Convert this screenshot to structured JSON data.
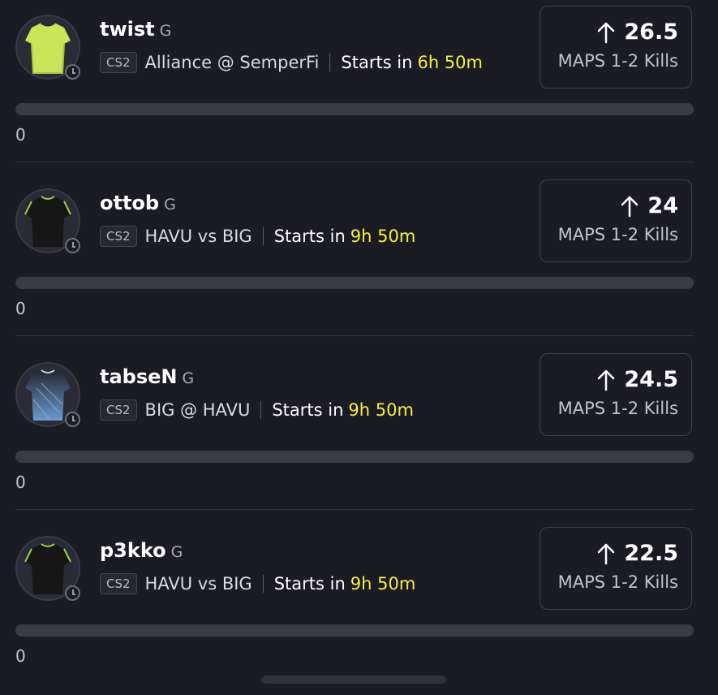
{
  "picks": [
    {
      "player": "twist",
      "position": "G",
      "game": "CS2",
      "matchup": "Alliance @ SemperFi",
      "starts_label": "Starts in",
      "starts_time": "6h 50m",
      "line": "26.5",
      "stat": "MAPS 1-2 Kills",
      "direction_icon": "arrow-up-icon",
      "count": "0",
      "progress": 0,
      "jersey_color": "#c9e65a"
    },
    {
      "player": "ottob",
      "position": "G",
      "game": "CS2",
      "matchup": "HAVU vs BIG",
      "starts_label": "Starts in",
      "starts_time": "9h 50m",
      "line": "24",
      "stat": "MAPS 1-2 Kills",
      "direction_icon": "arrow-up-icon",
      "count": "0",
      "progress": 0,
      "jersey_color": "#1a1a1a"
    },
    {
      "player": "tabseN",
      "position": "G",
      "game": "CS2",
      "matchup": "BIG @ HAVU",
      "starts_label": "Starts in",
      "starts_time": "9h 50m",
      "line": "24.5",
      "stat": "MAPS 1-2 Kills",
      "direction_icon": "arrow-up-icon",
      "count": "0",
      "progress": 0,
      "jersey_color": "#5a7fa8"
    },
    {
      "player": "p3kko",
      "position": "G",
      "game": "CS2",
      "matchup": "HAVU vs BIG",
      "starts_label": "Starts in",
      "starts_time": "9h 50m",
      "line": "22.5",
      "stat": "MAPS 1-2 Kills",
      "direction_icon": "arrow-up-icon",
      "count": "0",
      "progress": 0,
      "jersey_color": "#1a1a1a"
    }
  ],
  "colors": {
    "background": "#1b1b24",
    "time_highlight": "#f5ee46",
    "border": "#3f404f"
  }
}
